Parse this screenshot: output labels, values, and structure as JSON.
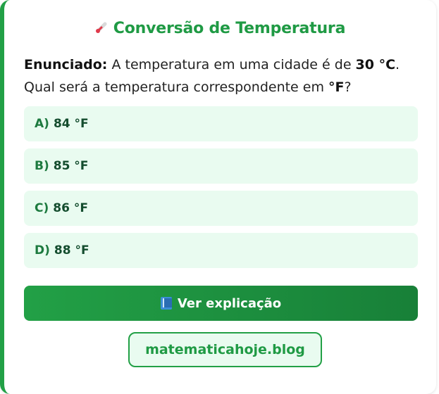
{
  "quiz": {
    "title": "Conversão de Temperatura",
    "title_icon": "thermometer-icon",
    "statement": {
      "label": "Enunciado:",
      "text_1": " A temperatura em uma cidade é de ",
      "value_c": "30 °C",
      "text_2": ". Qual será a temperatura correspondente em ",
      "unit_f": "°F",
      "text_3": "?"
    },
    "options": [
      {
        "letter": "A)",
        "text": "84 °F"
      },
      {
        "letter": "B)",
        "text": "85 °F"
      },
      {
        "letter": "C)",
        "text": "86 °F"
      },
      {
        "letter": "D)",
        "text": "88 °F"
      }
    ],
    "explain_button": {
      "icon": "book-icon",
      "label": "Ver explicação"
    },
    "blog_link": "matematicahoje.blog"
  },
  "colors": {
    "accent": "#22a046",
    "option_bg": "#e9fbf0",
    "title": "#1f9a44"
  }
}
